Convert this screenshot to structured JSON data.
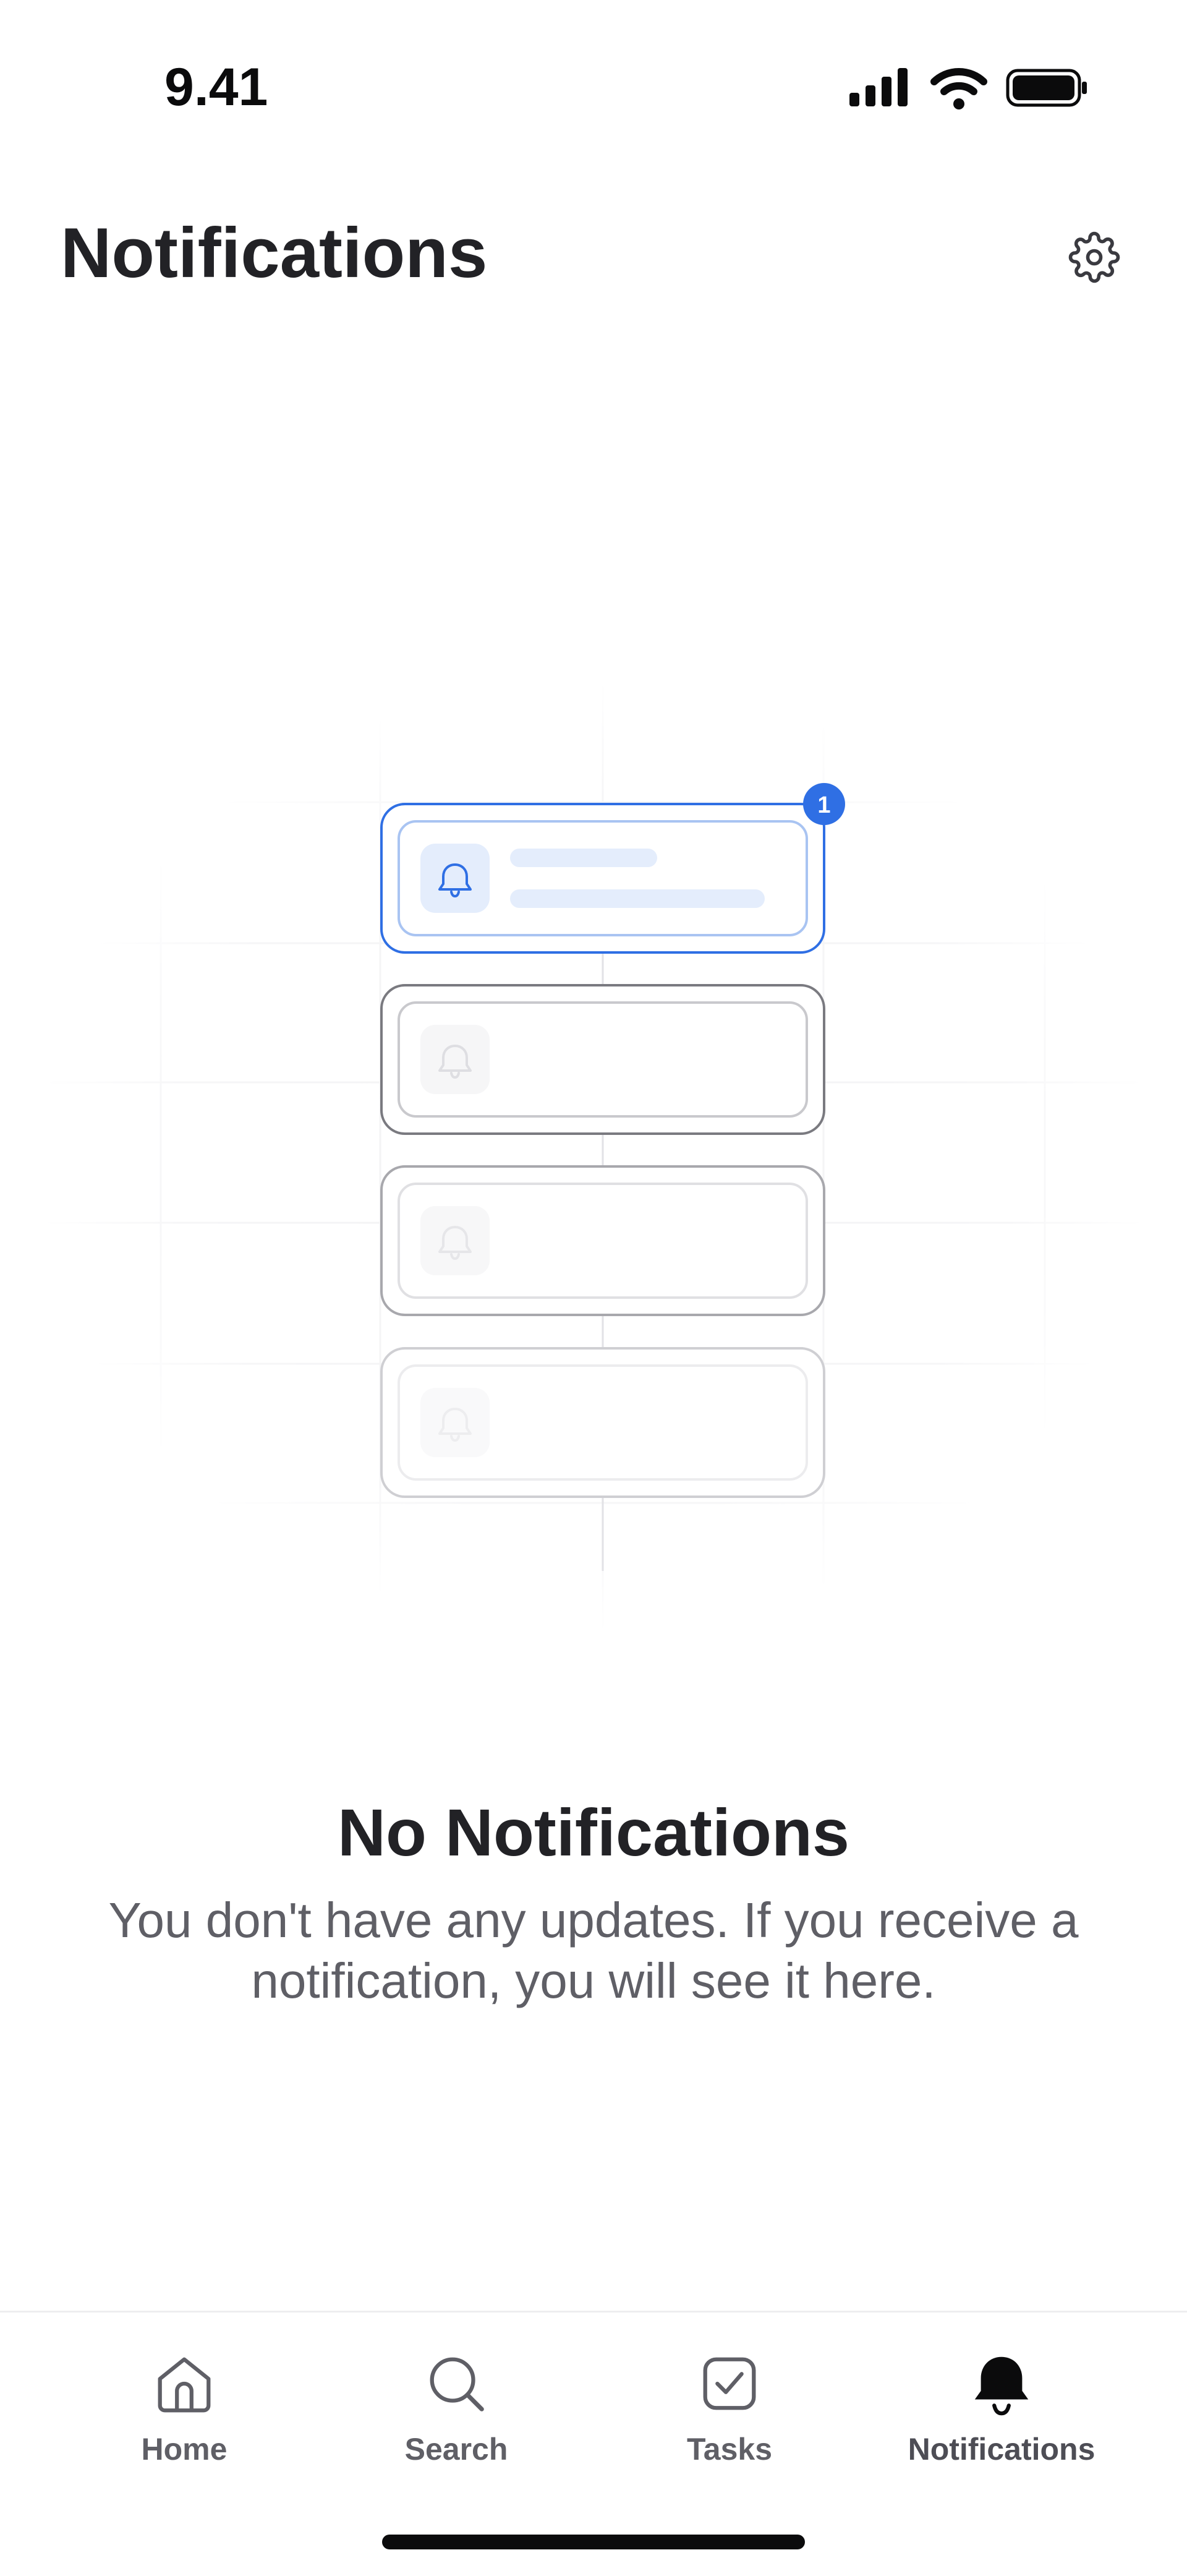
{
  "status_bar": {
    "time": "9.41",
    "icons": [
      "signal-icon",
      "wifi-icon",
      "battery-icon"
    ]
  },
  "header": {
    "title": "Notifications",
    "settings_icon": "gear-icon"
  },
  "illustration": {
    "badge_count": "1",
    "card_icon": "bell-icon",
    "accent_color": "#2f6fe4"
  },
  "empty_state": {
    "title": "No Notifications",
    "message": "You don't have any updates. If you receive a notification, you will see it here."
  },
  "tab_bar": {
    "items": [
      {
        "label": "Home",
        "icon": "home-icon",
        "active": false
      },
      {
        "label": "Search",
        "icon": "search-icon",
        "active": false
      },
      {
        "label": "Tasks",
        "icon": "checkbox-icon",
        "active": false
      },
      {
        "label": "Notifications",
        "icon": "bell-filled-icon",
        "active": true
      }
    ]
  },
  "colors": {
    "text_primary": "#222226",
    "text_secondary": "#5f5f66",
    "accent": "#2f6fe4"
  }
}
